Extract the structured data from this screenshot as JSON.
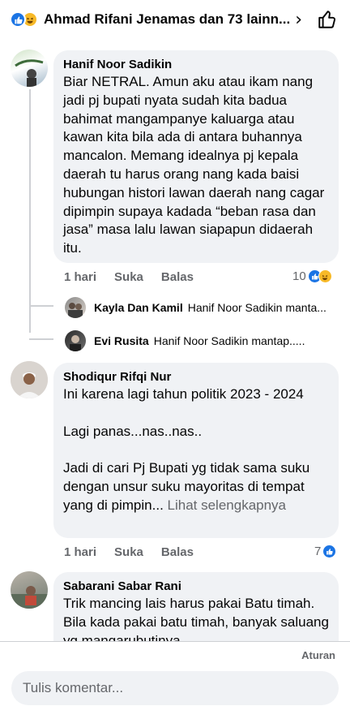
{
  "header": {
    "title": "Ahmad Rifani Jenamas dan 73 lainn...",
    "reactions": [
      "like-icon",
      "haha-icon"
    ],
    "chevron": "›"
  },
  "comments": [
    {
      "author": "Hanif Noor Sadikin",
      "text": "Biar NETRAL. Amun aku atau ikam nang jadi pj bupati nyata sudah kita badua bahimat mangampanye kaluarga atau kawan kita bila ada di antara buhannya mancalon. Memang idealnya pj kepala daerah tu harus orang nang kada baisi hubungan histori lawan daerah nang cagar dipimpin supaya kadada “beban rasa dan jasa” masa lalu lawan siapapun didaerah itu.",
      "time": "1 hari",
      "like_label": "Suka",
      "reply_label": "Balas",
      "reaction_count": "10",
      "replies": [
        {
          "name": "Kayla Dan Kamil",
          "text": "Hanif Noor Sadikin manta..."
        },
        {
          "name": "Evi Rusita",
          "text": "Hanif Noor Sadikin mantap....."
        }
      ]
    },
    {
      "author": "Shodiqur Rifqi Nur",
      "text": "Ini karena lagi  tahun politik 2023 - 2024\n\nLagi panas...nas..nas..\n\nJadi  di cari  Pj  Bupati  yg  tidak  sama suku  dengan  unsur  suku  mayoritas   di tempat yang  di pimpin... ",
      "see_more": "Lihat selengkapnya",
      "time": "1 hari",
      "like_label": "Suka",
      "reply_label": "Balas",
      "reaction_count": "7"
    },
    {
      "author": "Sabarani Sabar Rani",
      "text": "Trik mancing lais harus pakai Batu timah. Bila kada pakai batu timah, banyak saluang yg mangarubutinya"
    }
  ],
  "footer": {
    "rules_label": "Aturan",
    "input_placeholder": "Tulis komentar..."
  },
  "colors": {
    "like": "#1b74e4",
    "haha": "#f7b928",
    "bubble": "#f0f2f5",
    "muted": "#65676b"
  }
}
